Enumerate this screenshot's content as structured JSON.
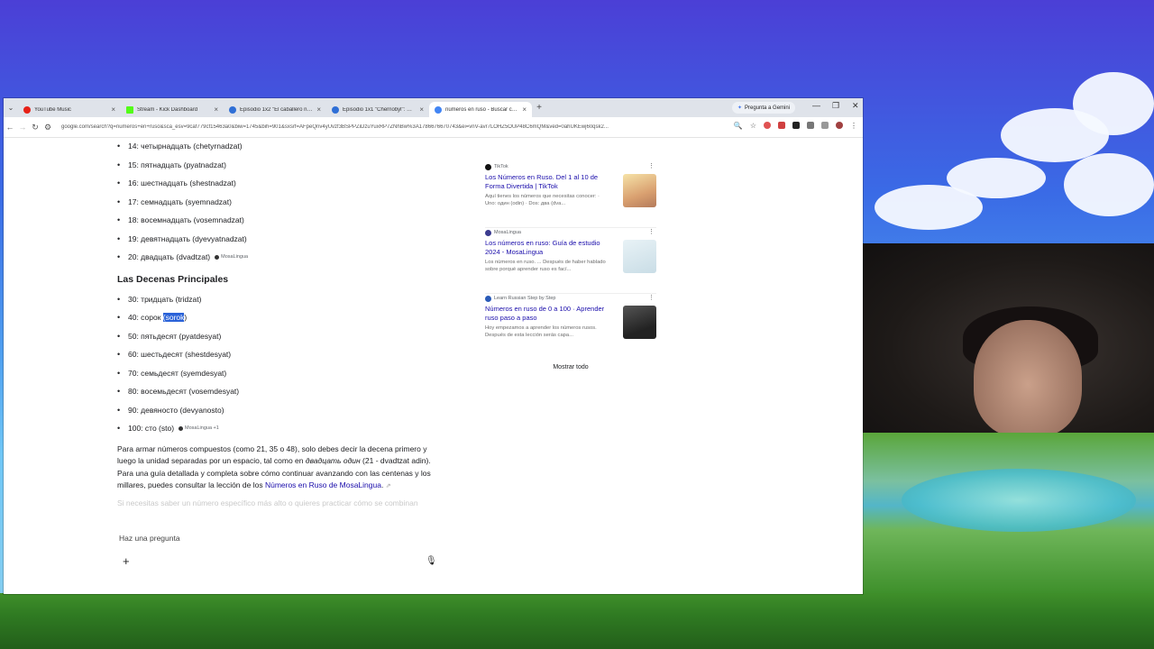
{
  "tabs": [
    {
      "label": "YouTube Music",
      "color": "#e62117",
      "active": false
    },
    {
      "label": "Stream - Kick Dashboard",
      "color": "#53fc18",
      "active": false
    },
    {
      "label": "Episodio 1x2 \"El caballero negr...",
      "color": "#2f6fd6",
      "active": false
    },
    {
      "label": "Episodio 1x1 \"Chernobyl\": Onli...",
      "color": "#2f6fd6",
      "active": false
    },
    {
      "label": "números en ruso - Buscar con...",
      "color": "#4285f4",
      "active": true
    }
  ],
  "gemini_label": "Pregunta a Gemini",
  "url": "google.com/search?q=numeros+en+ruso&sca_esv=9caf779cf15463a0&biw=1745&bih=901&sxsrf=AFpeQnv4yUvzf3BSPPZiDzuYuxRP7ZNhBw%3A1786676670743&ei=vnV-avr7LOHZ5OUP48C6mQM&ved=0ahUKEwj60qsk2...",
  "numbers_list": [
    "14: четырнадцать (chetyrnadzat)",
    "15: пятнадцать (pyatnadzat)",
    "16: шестнадцать (shestnadzat)",
    "17: семнадцать (syemnadzat)",
    "18: восемнадцать (vosemnadzat)",
    "19: девятнадцать (dyevyatnadzat)",
    "20: двадцать (dvadtzat)"
  ],
  "source_chip_1": "MosaLingua",
  "section_heading": "Las Decenas Principales",
  "tens": {
    "t30": "30: тридцать (tridzat)",
    "t40_prefix": "40: сорок ",
    "t40_selected": "(sorok",
    "t40_suffix": ")",
    "t50": "50: пятьдесят (pyatdesyat)",
    "t60": "60: шестьдесят (shestdesyat)",
    "t70": "70: семьдесят (syemdesyat)",
    "t80": "80: восемьдесят (vosemdesyat)",
    "t90": "90: девяносто (devyanosto)",
    "t100": "100: сто (sto)"
  },
  "source_chip_2": "MosaLingua +1",
  "paragraph": {
    "part1": "Para armar números compuestos (como 21, 35 o 48), solo debes decir la decena primero y luego la unidad separadas por un espacio, tal como en ",
    "italic": "двадцать один",
    "part2": " (21 - dvadtzat adin). Para una guía detallada y completa sobre cómo continuar avanzando con las centenas y los millares, puedes consultar la lección de los ",
    "link": "Números en Ruso de MosaLingua",
    "part3": "."
  },
  "faded_text": "Si necesitas saber un número específico más alto o quieres practicar cómo se combinan",
  "ask_placeholder": "Haz una pregunta",
  "cards": [
    {
      "source": "TikTok",
      "title": "Los Números en Ruso. Del 1 al 10 de Forma Divertida | TikTok",
      "snippet": "Aquí tienes los números que necesitas conocer: · Uno: один (odin) · Dos: два (dva...",
      "thumb_color": "#e8c9a0"
    },
    {
      "source": "MosaLingua",
      "title": "Los números en ruso: Guía de estudio 2024 - MosaLingua",
      "snippet": "Los números en ruso. ... Después de haber hablado sobre porqué aprender ruso es fací...",
      "thumb_color": "#d9e8ef"
    },
    {
      "source": "Learn Russian Step by Step",
      "title": "Números en ruso de 0 a 100 · Aprender ruso paso a paso",
      "snippet": "Hoy empezamos a aprender los números rusos. Después de esta lección serás capa...",
      "thumb_color": "#3a3a3a"
    }
  ],
  "show_all": "Mostrar todo"
}
